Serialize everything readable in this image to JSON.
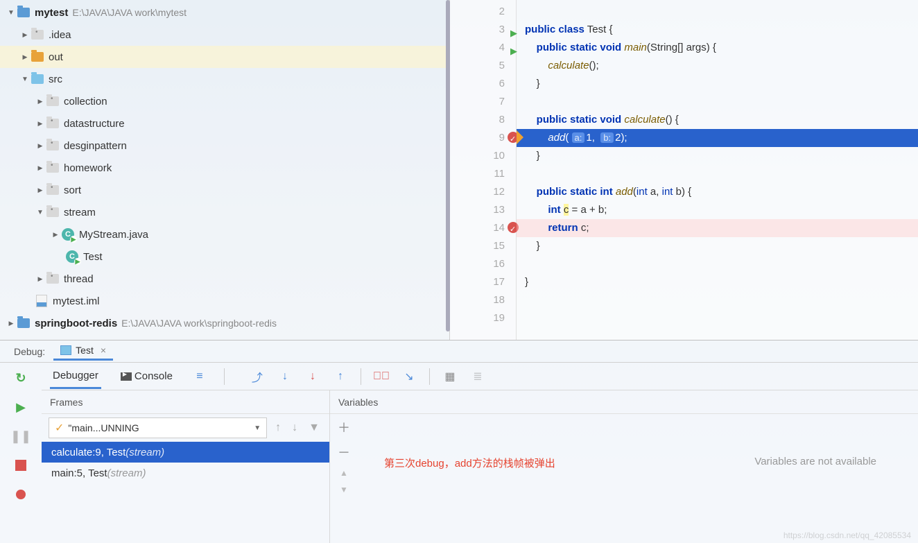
{
  "tree": {
    "p1": {
      "name": "mytest",
      "path": "E:\\JAVA\\JAVA work\\mytest"
    },
    "idea": ".idea",
    "out": "out",
    "src": "src",
    "pkg": {
      "collection": "collection",
      "datastructure": "datastructure",
      "desginpattern": "desginpattern",
      "homework": "homework",
      "sort": "sort",
      "stream": "stream",
      "thread": "thread"
    },
    "files": {
      "mystream": "MyStream.java",
      "test": "Test",
      "iml": "mytest.iml"
    },
    "p2": {
      "name": "springboot-redis",
      "path": "E:\\JAVA\\JAVA work\\springboot-redis"
    }
  },
  "code": {
    "lines": [
      "2",
      "3",
      "4",
      "5",
      "6",
      "7",
      "8",
      "9",
      "10",
      "11",
      "12",
      "13",
      "14",
      "15",
      "16",
      "17",
      "18",
      "19"
    ],
    "l3": {
      "kw1": "public",
      "kw2": "class",
      "cls": "Test",
      "br": "{"
    },
    "l4": {
      "kw1": "public",
      "kw2": "static",
      "kw3": "void",
      "fn": "main",
      "sig": "(String[] args) {"
    },
    "l5": {
      "fn": "calculate",
      "rest": "();"
    },
    "l6": "}",
    "l8": {
      "kw1": "public",
      "kw2": "static",
      "kw3": "void",
      "fn": "calculate",
      "sig": "() {"
    },
    "l9": {
      "fn": "add",
      "h1": "a:",
      "v1": "1",
      "h2": "b:",
      "v2": "2",
      "rest": ");"
    },
    "l10": "}",
    "l12": {
      "kw1": "public",
      "kw2": "static",
      "kw3": "int",
      "fn": "add",
      "sig": "(",
      "t1": "int",
      "p1": " a, ",
      "t2": "int",
      "p2": " b) {"
    },
    "l13": {
      "kw": "int",
      "var": "c",
      "rest": " = a + b;"
    },
    "l14": {
      "kw": "return",
      "rest": " c;"
    },
    "l15": "}",
    "l17": "}"
  },
  "debug": {
    "label": "Debug:",
    "tab": "Test",
    "debugger": "Debugger",
    "console": "Console",
    "frames_hdr": "Frames",
    "vars_hdr": "Variables",
    "thread": "\"main...UNNING",
    "frame1": {
      "main": "calculate:9, Test ",
      "pkg": "(stream)"
    },
    "frame2": {
      "main": "main:5, Test ",
      "pkg": "(stream)"
    },
    "annotation": "第三次debug，add方法的栈帧被弹出",
    "vars_msg": "Variables are not available"
  },
  "watermark": "https://blog.csdn.net/qq_42085534"
}
